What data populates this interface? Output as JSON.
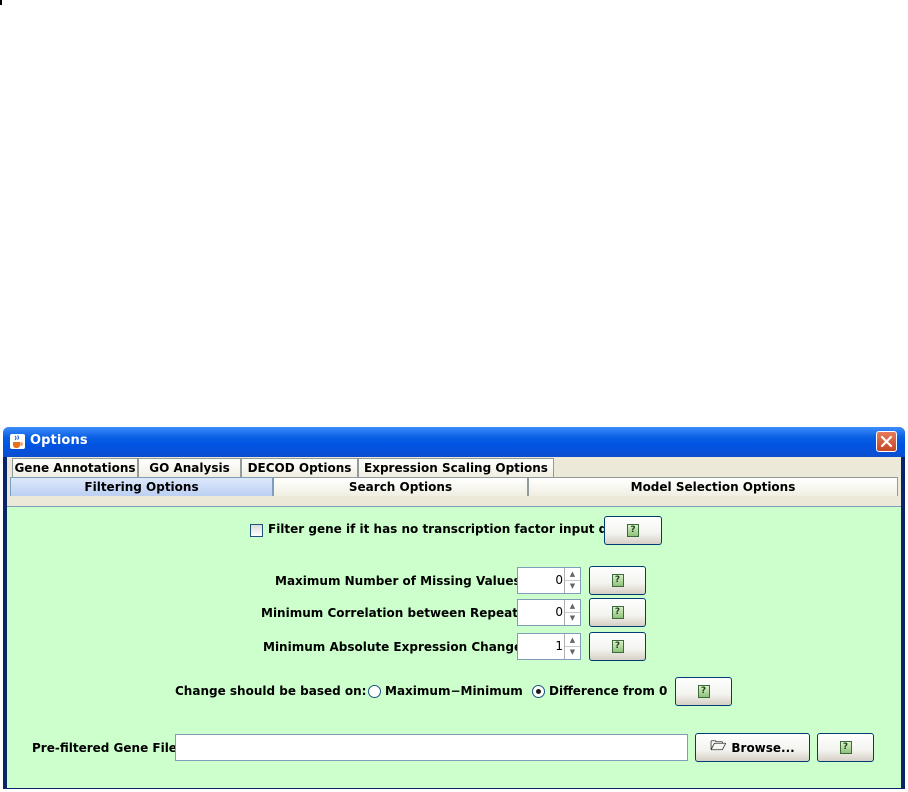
{
  "window": {
    "title": "Options",
    "icon": "java-cup-icon",
    "close_icon": "close-x-icon",
    "colors": {
      "titlebar": "#0054e3",
      "panel": "#ccffcc",
      "client": "#ece9d8",
      "close": "#d9532f"
    }
  },
  "tabs": {
    "row1": [
      "Gene Annotations",
      "GO Analysis",
      "DECOD Options",
      "Expression Scaling Options"
    ],
    "row2": [
      "Filtering Options",
      "Search Options",
      "Model Selection Options"
    ],
    "active": "Filtering Options"
  },
  "filtering": {
    "filter_checkbox": {
      "label": "Filter gene if it has no transcription factor input data",
      "checked": false
    },
    "max_missing": {
      "label": "Maximum Number of Missing Values:",
      "value": "0"
    },
    "min_correlation": {
      "label": "Minimum Correlation between Repeats:",
      "value": "0"
    },
    "min_abs_change": {
      "label": "Minimum Absolute Expression Change:",
      "value": "1"
    },
    "change_basis": {
      "label": "Change should be based on:",
      "options": [
        "Maximum−Minimum",
        "Difference from 0"
      ],
      "selected": "Difference from 0"
    },
    "prefiltered_file": {
      "label": "Pre-filtered Gene File:",
      "value": "",
      "browse_label": "Browse..."
    }
  },
  "icons": {
    "help": "help-question-icon",
    "folder": "folder-open-icon",
    "spin_up": "arrow-up-icon",
    "spin_down": "arrow-down-icon"
  }
}
